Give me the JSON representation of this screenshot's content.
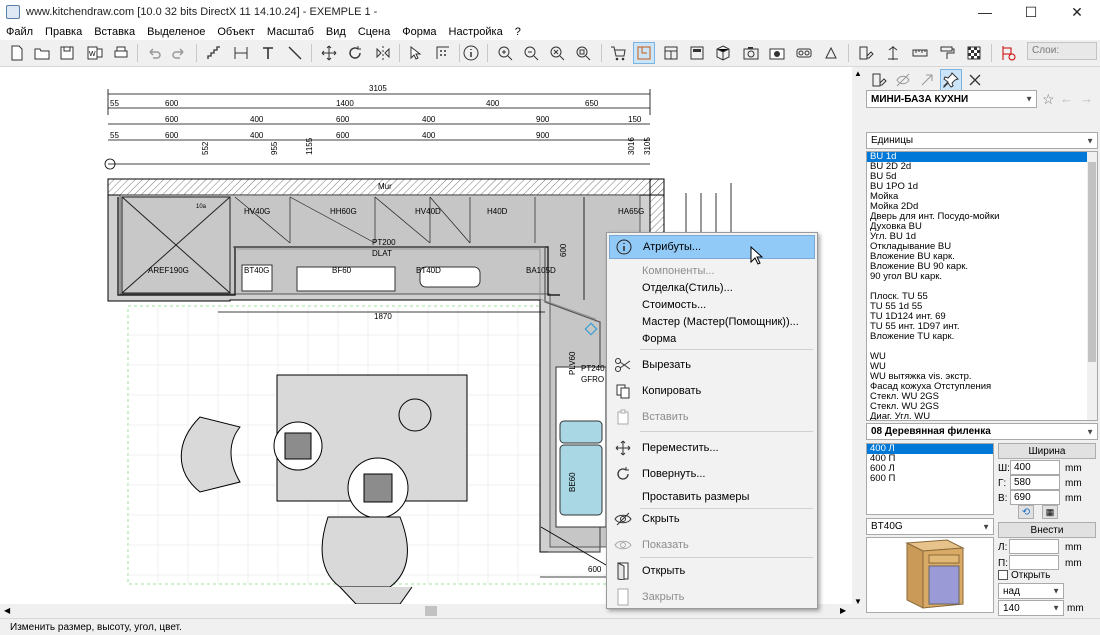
{
  "window": {
    "title": "www.kitchendraw.com [10.0 32 bits DirectX 11 14.10.24] - EXEMPLE 1 -",
    "minimize": "—",
    "maximize": "☐",
    "close": "✕"
  },
  "menu": [
    "Файл",
    "Правка",
    "Вставка",
    "Выделеное",
    "Объект",
    "Масштаб",
    "Вид",
    "Сцена",
    "Форма",
    "Настройка",
    "?"
  ],
  "toolbar": {
    "layer_label": "Слои:"
  },
  "drawing": {
    "dim_total": "3105",
    "dims_row1": [
      "55",
      "600",
      "1400",
      "400",
      "650"
    ],
    "dims_row2": [
      "600",
      "400",
      "600",
      "400",
      "900",
      "150"
    ],
    "dims_row3": [
      "55",
      "600",
      "400",
      "600",
      "400",
      "900"
    ],
    "vert_dims": [
      "552",
      "955",
      "1155",
      "3016",
      "3105"
    ],
    "labels": {
      "mur": "Mur",
      "hv40g": "HV40G",
      "hh60g": "HH60G",
      "hv40d": "HV40D",
      "h40d": "H40D",
      "ha65g": "HA65G",
      "pt200": "PT200",
      "dlat": "DLAT",
      "aref190g": "AREF190G",
      "bt40g": "BT40G",
      "bf60": "BF60",
      "bt40d": "BT40D",
      "ba105d": "BA105D",
      "dim_1870": "1870",
      "dim_600v": "600",
      "plv60": "PLV60",
      "pt240": "PT240",
      "gfro": "GFRO",
      "be60": "BE60",
      "dim_600b": "600",
      "small": "10a"
    }
  },
  "context_menu": {
    "items": [
      {
        "label": "Атрибуты...",
        "icon": "info-icon",
        "state": "highlighted"
      },
      {
        "label": "Компоненты...",
        "icon": "",
        "state": "disabled"
      },
      {
        "label": "Отделка(Стиль)...",
        "icon": "",
        "state": "normal"
      },
      {
        "label": "Стоимость...",
        "icon": "",
        "state": "normal"
      },
      {
        "label": "Мастер (Мастер(Помощник))...",
        "icon": "",
        "state": "normal"
      },
      {
        "label": "Форма",
        "icon": "",
        "state": "normal"
      },
      {
        "label": "Вырезать",
        "icon": "scissors-icon",
        "state": "normal"
      },
      {
        "label": "Копировать",
        "icon": "copy-icon",
        "state": "normal"
      },
      {
        "label": "Вставить",
        "icon": "paste-icon",
        "state": "disabled"
      },
      {
        "label": "Переместить...",
        "icon": "move-icon",
        "state": "normal"
      },
      {
        "label": "Повернуть...",
        "icon": "rotate-icon",
        "state": "normal"
      },
      {
        "label": "Проставить размеры",
        "icon": "",
        "state": "normal"
      },
      {
        "label": "Скрыть",
        "icon": "hide-eye-icon",
        "state": "normal"
      },
      {
        "label": "Показать",
        "icon": "show-eye-icon",
        "state": "disabled"
      },
      {
        "label": "Открыть",
        "icon": "open-door-icon",
        "state": "normal"
      },
      {
        "label": "Закрыть",
        "icon": "close-door-icon",
        "state": "disabled"
      }
    ]
  },
  "panel": {
    "catalog": "МИНИ-БАЗА КУХНИ",
    "category": "Единицы",
    "items": [
      "BU  1d",
      "BU 2D  2d",
      "BU 5d",
      "BU 1PO  1d",
      "Мойка",
      "Мойка  2Dd",
      "Дверь для инт. Посудо-мойки",
      "Духовка BU",
      "Угл. BU  1d",
      "Откладывание BU",
      "Вложение BU карк.",
      "Вложение BU 90  карк.",
      "90  угол BU карк.",
      "",
      "Плоск. TU 55",
      "TU 55 1d  55",
      "TU 1D124 инт.  69",
      "TU 55 инт. 1D97 инт.",
      "Вложение TU карк.",
      "",
      "WU",
      "WU",
      "WU вытяжка vis. экстр.",
      "Фасад кожуха Отступления",
      "Стекл. WU  2GS",
      "Стекл. WU  2GS",
      "Диаг. Угл. WU"
    ],
    "selected_index": 0,
    "finish": "08        Деревянная филенка",
    "widths": [
      "400 Л",
      "400 П",
      "600 Л",
      "600 П"
    ],
    "width_button": "Ширина",
    "w_label": "Ш:",
    "w_value": "400",
    "d_label": "Г:",
    "d_value": "580",
    "h_label": "В:",
    "h_value": "690",
    "unit": "mm",
    "model": "BT40G",
    "insert_button": "Внести",
    "l_label": "Л:",
    "p_label": "П:",
    "open_checkbox": "Открыть",
    "position": "над",
    "position_value": "140"
  },
  "status": "Изменить размер, высоту, угол, цвет."
}
